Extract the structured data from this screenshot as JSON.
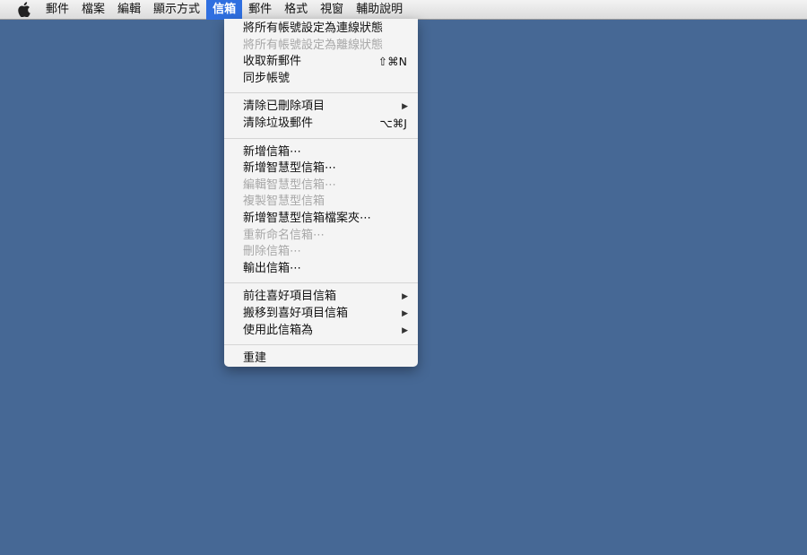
{
  "menubar": {
    "items": [
      {
        "label": "郵件"
      },
      {
        "label": "檔案"
      },
      {
        "label": "編輯"
      },
      {
        "label": "顯示方式"
      },
      {
        "label": "信箱",
        "active": true
      },
      {
        "label": "郵件"
      },
      {
        "label": "格式"
      },
      {
        "label": "視窗"
      },
      {
        "label": "輔助說明"
      }
    ]
  },
  "mailbox_menu": {
    "group1": [
      {
        "label": "將所有帳號設定為連線狀態",
        "enabled": true
      },
      {
        "label": "將所有帳號設定為離線狀態",
        "enabled": false
      },
      {
        "label": "收取新郵件",
        "shortcut": "⇧⌘N",
        "enabled": true
      },
      {
        "label": "同步帳號",
        "enabled": true
      }
    ],
    "group2": [
      {
        "label": "清除已刪除項目",
        "submenu": true,
        "enabled": true
      },
      {
        "label": "清除垃圾郵件",
        "shortcut": "⌥⌘J",
        "enabled": true
      }
    ],
    "group3": [
      {
        "label": "新增信箱⋯",
        "enabled": true
      },
      {
        "label": "新增智慧型信箱⋯",
        "enabled": true
      },
      {
        "label": "編輯智慧型信箱⋯",
        "enabled": false
      },
      {
        "label": "複製智慧型信箱",
        "enabled": false
      },
      {
        "label": "新增智慧型信箱檔案夾⋯",
        "enabled": true
      },
      {
        "label": "重新命名信箱⋯",
        "enabled": false
      },
      {
        "label": "刪除信箱⋯",
        "enabled": false
      },
      {
        "label": "輸出信箱⋯",
        "enabled": true
      }
    ],
    "group4": [
      {
        "label": "前往喜好項目信箱",
        "submenu": true,
        "enabled": true
      },
      {
        "label": "搬移到喜好項目信箱",
        "submenu": true,
        "enabled": true
      },
      {
        "label": "使用此信箱為",
        "submenu": true,
        "enabled": true
      }
    ],
    "group5": [
      {
        "label": "重建",
        "enabled": true
      }
    ]
  },
  "icons": {
    "apple": "apple-logo-icon",
    "submenu_arrow": "▶"
  },
  "colors": {
    "desktop": "#466895",
    "menu_highlight": "#2f6fe0",
    "disabled_text": "#a8a8a8"
  }
}
